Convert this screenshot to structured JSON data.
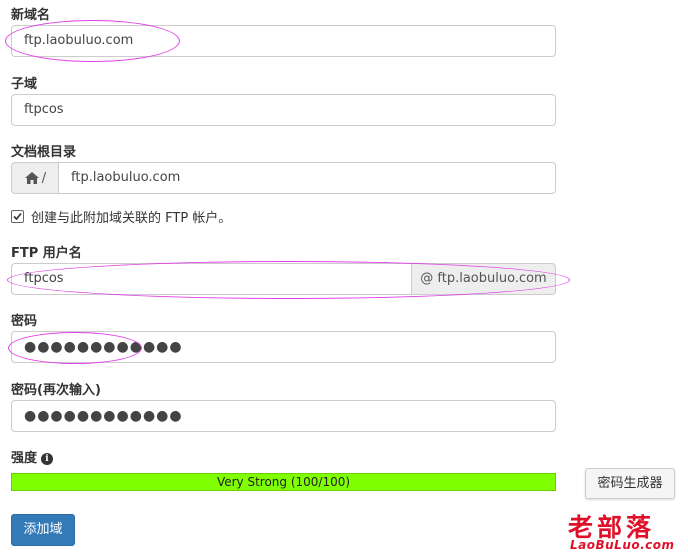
{
  "form": {
    "new_domain": {
      "label": "新域名",
      "value": "ftp.laobuluo.com"
    },
    "subdomain": {
      "label": "子域",
      "value": "ftpcos"
    },
    "document_root": {
      "label": "文档根目录",
      "prefix": "/",
      "value": "ftp.laobuluo.com"
    },
    "create_ftp": {
      "label": "创建与此附加域关联的 FTP 帐户。",
      "checked": true
    },
    "ftp_username": {
      "label": "FTP 用户名",
      "value": "ftpcos",
      "suffix": "@ ftp.laobuluo.com"
    },
    "password": {
      "label": "密码",
      "value": "●●●●●●●●●●●●"
    },
    "password_confirm": {
      "label": "密码(再次输入)",
      "value": "●●●●●●●●●●●●"
    },
    "strength": {
      "label": "强度",
      "info_icon_text": "i",
      "text": "Very Strong (100/100)",
      "level": 1.0,
      "color": "#80ff00"
    },
    "generate_button": "密码生成器",
    "submit_button": "添加域"
  },
  "watermark": {
    "cn": "老部落",
    "en": "LaoBuLuo.com",
    "color": "#e0102a"
  },
  "colors": {
    "accent": "#337ab7",
    "highlight": "#e040e8"
  }
}
